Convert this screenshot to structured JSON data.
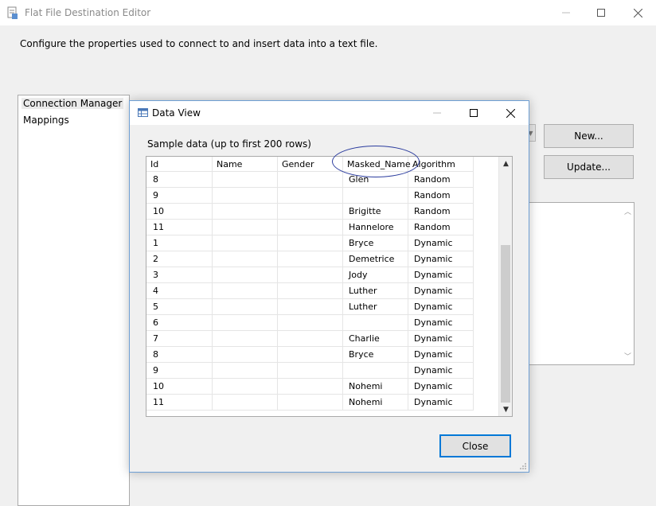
{
  "outer": {
    "title": "Flat File Destination Editor",
    "description": "Configure the properties used to connect to and insert data into a text file.",
    "nav": [
      "Connection Manager",
      "Mappings"
    ],
    "buttons": {
      "new": "New...",
      "update": "Update..."
    }
  },
  "dialog": {
    "title": "Data View",
    "sample_label": "Sample data (up to first 200 rows)",
    "close_label": "Close",
    "columns": [
      "Id",
      "Name",
      "Gender",
      "Masked_Name",
      "Algorithm"
    ],
    "rows": [
      [
        "8",
        "",
        "",
        "Glen",
        "Random"
      ],
      [
        "9",
        "",
        "",
        "",
        "Random"
      ],
      [
        "10",
        "",
        "",
        "Brigitte",
        "Random"
      ],
      [
        "11",
        "",
        "",
        "Hannelore",
        "Random"
      ],
      [
        "1",
        "",
        "",
        "Bryce",
        "Dynamic"
      ],
      [
        "2",
        "",
        "",
        "Demetrice",
        "Dynamic"
      ],
      [
        "3",
        "",
        "",
        "Jody",
        "Dynamic"
      ],
      [
        "4",
        "",
        "",
        "Luther",
        "Dynamic"
      ],
      [
        "5",
        "",
        "",
        "Luther",
        "Dynamic"
      ],
      [
        "6",
        "",
        "",
        "",
        "Dynamic"
      ],
      [
        "7",
        "",
        "",
        "Charlie",
        "Dynamic"
      ],
      [
        "8",
        "",
        "",
        "Bryce",
        "Dynamic"
      ],
      [
        "9",
        "",
        "",
        "",
        "Dynamic"
      ],
      [
        "10",
        "",
        "",
        "Nohemi",
        "Dynamic"
      ],
      [
        "11",
        "",
        "",
        "Nohemi",
        "Dynamic"
      ]
    ]
  },
  "colors": {
    "accent": "#0078d7",
    "annotation": "#2b3c9e"
  }
}
